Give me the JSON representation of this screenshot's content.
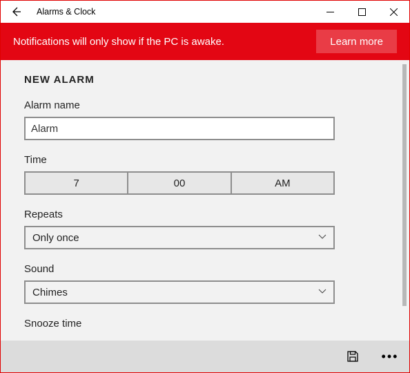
{
  "window": {
    "title": "Alarms & Clock"
  },
  "notification": {
    "text": "Notifications will only show if the PC is awake.",
    "learn_more": "Learn more"
  },
  "form": {
    "heading": "NEW ALARM",
    "alarm_name_label": "Alarm name",
    "alarm_name_value": "Alarm",
    "time_label": "Time",
    "time_hour": "7",
    "time_minute": "00",
    "time_ampm": "AM",
    "repeats_label": "Repeats",
    "repeats_value": "Only once",
    "sound_label": "Sound",
    "sound_value": "Chimes",
    "snooze_label": "Snooze time"
  },
  "icons": {
    "back": "back-arrow",
    "minimize": "minimize",
    "maximize": "maximize",
    "close": "close",
    "save": "save-disk",
    "more": "ellipsis",
    "chevron": "chevron-down"
  },
  "colors": {
    "accent": "#e30613",
    "border": "#8d8d8d",
    "panel": "#f2f2f2",
    "bottom": "#dcdcdc"
  }
}
